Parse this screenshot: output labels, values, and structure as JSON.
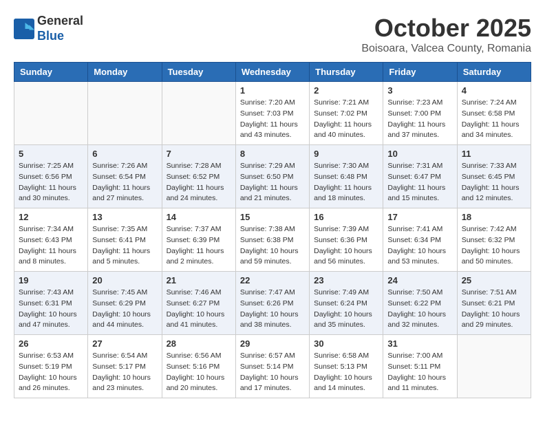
{
  "header": {
    "logo_general": "General",
    "logo_blue": "Blue",
    "month": "October 2025",
    "location": "Boisoara, Valcea County, Romania"
  },
  "weekdays": [
    "Sunday",
    "Monday",
    "Tuesday",
    "Wednesday",
    "Thursday",
    "Friday",
    "Saturday"
  ],
  "weeks": [
    [
      {
        "day": "",
        "sunrise": "",
        "sunset": "",
        "daylight": ""
      },
      {
        "day": "",
        "sunrise": "",
        "sunset": "",
        "daylight": ""
      },
      {
        "day": "",
        "sunrise": "",
        "sunset": "",
        "daylight": ""
      },
      {
        "day": "1",
        "sunrise": "Sunrise: 7:20 AM",
        "sunset": "Sunset: 7:03 PM",
        "daylight": "Daylight: 11 hours and 43 minutes."
      },
      {
        "day": "2",
        "sunrise": "Sunrise: 7:21 AM",
        "sunset": "Sunset: 7:02 PM",
        "daylight": "Daylight: 11 hours and 40 minutes."
      },
      {
        "day": "3",
        "sunrise": "Sunrise: 7:23 AM",
        "sunset": "Sunset: 7:00 PM",
        "daylight": "Daylight: 11 hours and 37 minutes."
      },
      {
        "day": "4",
        "sunrise": "Sunrise: 7:24 AM",
        "sunset": "Sunset: 6:58 PM",
        "daylight": "Daylight: 11 hours and 34 minutes."
      }
    ],
    [
      {
        "day": "5",
        "sunrise": "Sunrise: 7:25 AM",
        "sunset": "Sunset: 6:56 PM",
        "daylight": "Daylight: 11 hours and 30 minutes."
      },
      {
        "day": "6",
        "sunrise": "Sunrise: 7:26 AM",
        "sunset": "Sunset: 6:54 PM",
        "daylight": "Daylight: 11 hours and 27 minutes."
      },
      {
        "day": "7",
        "sunrise": "Sunrise: 7:28 AM",
        "sunset": "Sunset: 6:52 PM",
        "daylight": "Daylight: 11 hours and 24 minutes."
      },
      {
        "day": "8",
        "sunrise": "Sunrise: 7:29 AM",
        "sunset": "Sunset: 6:50 PM",
        "daylight": "Daylight: 11 hours and 21 minutes."
      },
      {
        "day": "9",
        "sunrise": "Sunrise: 7:30 AM",
        "sunset": "Sunset: 6:48 PM",
        "daylight": "Daylight: 11 hours and 18 minutes."
      },
      {
        "day": "10",
        "sunrise": "Sunrise: 7:31 AM",
        "sunset": "Sunset: 6:47 PM",
        "daylight": "Daylight: 11 hours and 15 minutes."
      },
      {
        "day": "11",
        "sunrise": "Sunrise: 7:33 AM",
        "sunset": "Sunset: 6:45 PM",
        "daylight": "Daylight: 11 hours and 12 minutes."
      }
    ],
    [
      {
        "day": "12",
        "sunrise": "Sunrise: 7:34 AM",
        "sunset": "Sunset: 6:43 PM",
        "daylight": "Daylight: 11 hours and 8 minutes."
      },
      {
        "day": "13",
        "sunrise": "Sunrise: 7:35 AM",
        "sunset": "Sunset: 6:41 PM",
        "daylight": "Daylight: 11 hours and 5 minutes."
      },
      {
        "day": "14",
        "sunrise": "Sunrise: 7:37 AM",
        "sunset": "Sunset: 6:39 PM",
        "daylight": "Daylight: 11 hours and 2 minutes."
      },
      {
        "day": "15",
        "sunrise": "Sunrise: 7:38 AM",
        "sunset": "Sunset: 6:38 PM",
        "daylight": "Daylight: 10 hours and 59 minutes."
      },
      {
        "day": "16",
        "sunrise": "Sunrise: 7:39 AM",
        "sunset": "Sunset: 6:36 PM",
        "daylight": "Daylight: 10 hours and 56 minutes."
      },
      {
        "day": "17",
        "sunrise": "Sunrise: 7:41 AM",
        "sunset": "Sunset: 6:34 PM",
        "daylight": "Daylight: 10 hours and 53 minutes."
      },
      {
        "day": "18",
        "sunrise": "Sunrise: 7:42 AM",
        "sunset": "Sunset: 6:32 PM",
        "daylight": "Daylight: 10 hours and 50 minutes."
      }
    ],
    [
      {
        "day": "19",
        "sunrise": "Sunrise: 7:43 AM",
        "sunset": "Sunset: 6:31 PM",
        "daylight": "Daylight: 10 hours and 47 minutes."
      },
      {
        "day": "20",
        "sunrise": "Sunrise: 7:45 AM",
        "sunset": "Sunset: 6:29 PM",
        "daylight": "Daylight: 10 hours and 44 minutes."
      },
      {
        "day": "21",
        "sunrise": "Sunrise: 7:46 AM",
        "sunset": "Sunset: 6:27 PM",
        "daylight": "Daylight: 10 hours and 41 minutes."
      },
      {
        "day": "22",
        "sunrise": "Sunrise: 7:47 AM",
        "sunset": "Sunset: 6:26 PM",
        "daylight": "Daylight: 10 hours and 38 minutes."
      },
      {
        "day": "23",
        "sunrise": "Sunrise: 7:49 AM",
        "sunset": "Sunset: 6:24 PM",
        "daylight": "Daylight: 10 hours and 35 minutes."
      },
      {
        "day": "24",
        "sunrise": "Sunrise: 7:50 AM",
        "sunset": "Sunset: 6:22 PM",
        "daylight": "Daylight: 10 hours and 32 minutes."
      },
      {
        "day": "25",
        "sunrise": "Sunrise: 7:51 AM",
        "sunset": "Sunset: 6:21 PM",
        "daylight": "Daylight: 10 hours and 29 minutes."
      }
    ],
    [
      {
        "day": "26",
        "sunrise": "Sunrise: 6:53 AM",
        "sunset": "Sunset: 5:19 PM",
        "daylight": "Daylight: 10 hours and 26 minutes."
      },
      {
        "day": "27",
        "sunrise": "Sunrise: 6:54 AM",
        "sunset": "Sunset: 5:17 PM",
        "daylight": "Daylight: 10 hours and 23 minutes."
      },
      {
        "day": "28",
        "sunrise": "Sunrise: 6:56 AM",
        "sunset": "Sunset: 5:16 PM",
        "daylight": "Daylight: 10 hours and 20 minutes."
      },
      {
        "day": "29",
        "sunrise": "Sunrise: 6:57 AM",
        "sunset": "Sunset: 5:14 PM",
        "daylight": "Daylight: 10 hours and 17 minutes."
      },
      {
        "day": "30",
        "sunrise": "Sunrise: 6:58 AM",
        "sunset": "Sunset: 5:13 PM",
        "daylight": "Daylight: 10 hours and 14 minutes."
      },
      {
        "day": "31",
        "sunrise": "Sunrise: 7:00 AM",
        "sunset": "Sunset: 5:11 PM",
        "daylight": "Daylight: 10 hours and 11 minutes."
      },
      {
        "day": "",
        "sunrise": "",
        "sunset": "",
        "daylight": ""
      }
    ]
  ]
}
